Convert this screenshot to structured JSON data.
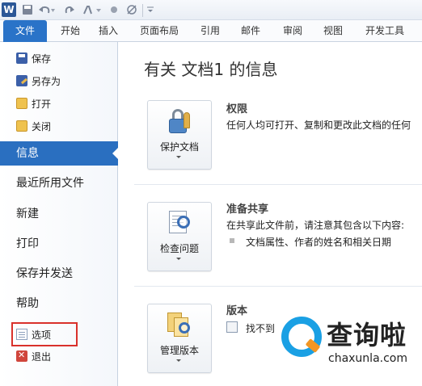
{
  "qat": {
    "app_icon_letter": "W",
    "separator": "|",
    "save_icon": "save-icon",
    "undo_icon": "undo-icon",
    "redo_icon": "redo-icon"
  },
  "tabs": [
    {
      "label": "文件"
    },
    {
      "label": "开始"
    },
    {
      "label": "插入"
    },
    {
      "label": "页面布局"
    },
    {
      "label": "引用"
    },
    {
      "label": "邮件"
    },
    {
      "label": "审阅"
    },
    {
      "label": "视图"
    },
    {
      "label": "开发工具"
    }
  ],
  "backstage": {
    "commands": {
      "save": "保存",
      "save_as": "另存为",
      "open": "打开",
      "close": "关闭"
    },
    "info": "信息",
    "recent": "最近所用文件",
    "new": "新建",
    "print": "打印",
    "save_send": "保存并发送",
    "help": "帮助",
    "options": "选项",
    "exit": "退出"
  },
  "main": {
    "title": "有关 文档1 的信息",
    "permissions": {
      "button": "保护文档",
      "heading": "权限",
      "text": "任何人均可打开、复制和更改此文档的任何"
    },
    "prepare": {
      "button": "检查问题",
      "heading": "准备共享",
      "text": "在共享此文件前，请注意其包含以下内容:",
      "bullet": "文档属性、作者的姓名和相关日期"
    },
    "versions": {
      "button": "管理版本",
      "heading": "版本",
      "text": "找不到"
    }
  },
  "watermark": {
    "text": "查询啦",
    "url": "chaxunla.com"
  },
  "colors": {
    "accent": "#2a6fc0",
    "file_tab": "#2a73c8",
    "highlight": "#d9312b",
    "watermark_blue": "#1aa0e4",
    "watermark_orange": "#f29624"
  }
}
